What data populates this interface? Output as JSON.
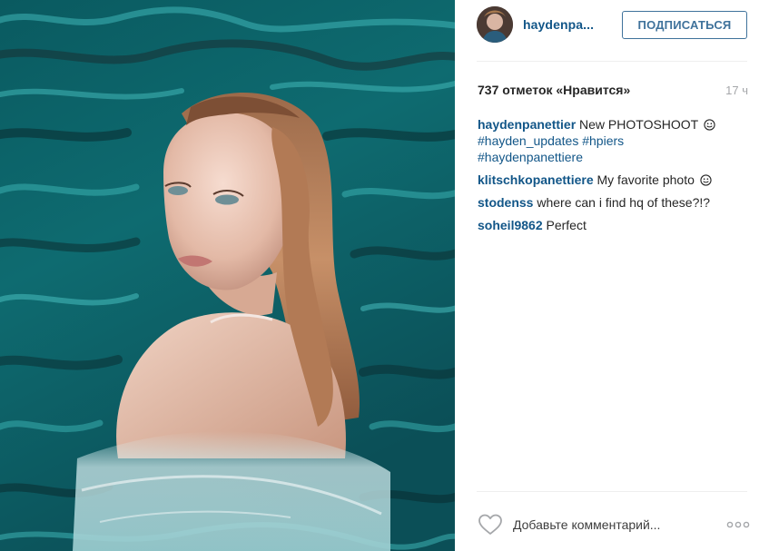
{
  "post": {
    "username": "haydenpa...",
    "follow_label": "ПОДПИСАТЬСЯ",
    "likes_text": "737 отметок «Нравится»",
    "time_ago": "17 ч",
    "caption": {
      "user": "haydenpanettier",
      "text": "New PHOTOSHOOT",
      "emoji": "smiley-icon",
      "hashtags": [
        "#hayden_updates",
        "#hpiers",
        "#haydenpanettiere"
      ]
    },
    "comments": [
      {
        "user": "klitschkopanettiere",
        "text": "My favorite photo",
        "emoji": "smiley-icon"
      },
      {
        "user": "stodenss",
        "text": "where can i find hq of these?!?"
      },
      {
        "user": "soheil9862",
        "text": "Perfect"
      }
    ],
    "comment_placeholder": "Добавьте комментарий...",
    "icons": {
      "like": "heart-outline-icon",
      "more": "more-options-icon"
    },
    "colors": {
      "link": "#125688",
      "follow_border": "#3f729b",
      "muted": "#a5a7aa",
      "water": "#0f5f66"
    }
  }
}
